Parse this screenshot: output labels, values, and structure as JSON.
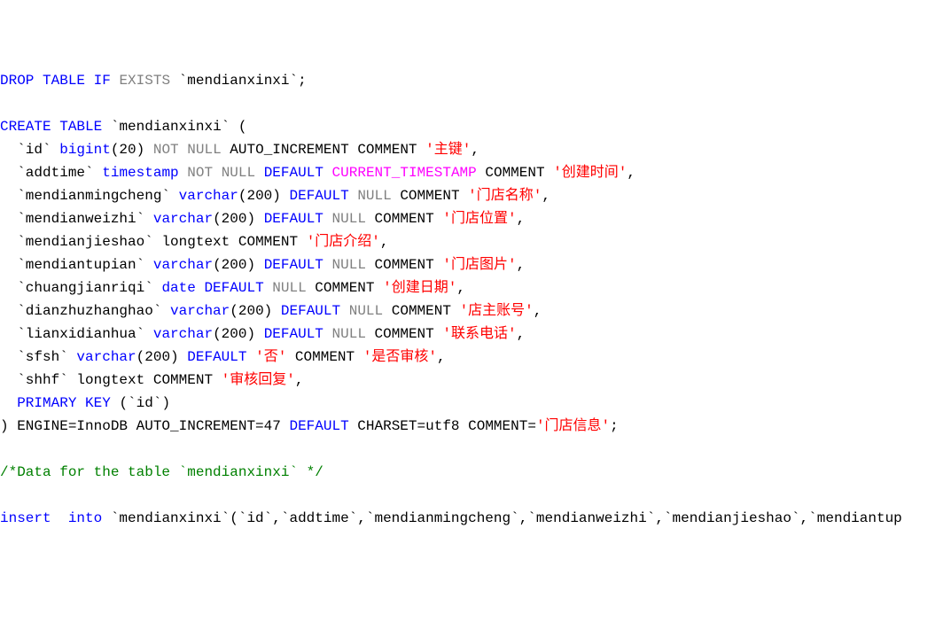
{
  "lines": {
    "l1_drop": "DROP",
    "l1_table": "TABLE",
    "l1_if": "IF",
    "l1_exists": "EXISTS",
    "l1_name": "`mendianxinxi`;",
    "l3_create": "CREATE",
    "l3_table": "TABLE",
    "l3_name": "`mendianxinxi` (",
    "l4_field": "  `id`",
    "l4_type": "bigint",
    "l4_size": "(20)",
    "l4_not": "NOT",
    "l4_null": "NULL",
    "l4_auto": "AUTO_INCREMENT",
    "l4_comment": "COMMENT",
    "l4_str": "'主键'",
    "l4_end": ",",
    "l5_field": "  `addtime`",
    "l5_type": "timestamp",
    "l5_not": "NOT",
    "l5_null": "NULL",
    "l5_default": "DEFAULT",
    "l5_curts": "CURRENT_TIMESTAMP",
    "l5_comment": "COMMENT",
    "l5_str": "'创建时间'",
    "l5_end": ",",
    "l6_field": "  `mendianmingcheng`",
    "l6_type": "varchar",
    "l6_size": "(200)",
    "l6_default": "DEFAULT",
    "l6_null": "NULL",
    "l6_comment": "COMMENT",
    "l6_str": "'门店名称'",
    "l6_end": ",",
    "l7_field": "  `mendianweizhi`",
    "l7_type": "varchar",
    "l7_size": "(200)",
    "l7_default": "DEFAULT",
    "l7_null": "NULL",
    "l7_comment": "COMMENT",
    "l7_str": "'门店位置'",
    "l7_end": ",",
    "l8_field": "  `mendianjieshao`",
    "l8_type": "longtext",
    "l8_comment": "COMMENT",
    "l8_str": "'门店介绍'",
    "l8_end": ",",
    "l9_field": "  `mendiantupian`",
    "l9_type": "varchar",
    "l9_size": "(200)",
    "l9_default": "DEFAULT",
    "l9_null": "NULL",
    "l9_comment": "COMMENT",
    "l9_str": "'门店图片'",
    "l9_end": ",",
    "l10_field": "  `chuangjianriqi`",
    "l10_type": "date",
    "l10_default": "DEFAULT",
    "l10_null": "NULL",
    "l10_comment": "COMMENT",
    "l10_str": "'创建日期'",
    "l10_end": ",",
    "l11_field": "  `dianzhuzhanghao`",
    "l11_type": "varchar",
    "l11_size": "(200)",
    "l11_default": "DEFAULT",
    "l11_null": "NULL",
    "l11_comment": "COMMENT",
    "l11_str": "'店主账号'",
    "l11_end": ",",
    "l12_field": "  `lianxidianhua`",
    "l12_type": "varchar",
    "l12_size": "(200)",
    "l12_default": "DEFAULT",
    "l12_null": "NULL",
    "l12_comment": "COMMENT",
    "l12_str": "'联系电话'",
    "l12_end": ",",
    "l13_field": "  `sfsh`",
    "l13_type": "varchar",
    "l13_size": "(200)",
    "l13_default": "DEFAULT",
    "l13_str1": "'否'",
    "l13_comment": "COMMENT",
    "l13_str2": "'是否审核'",
    "l13_end": ",",
    "l14_field": "  `shhf`",
    "l14_type": "longtext",
    "l14_comment": "COMMENT",
    "l14_str": "'审核回复'",
    "l14_end": ",",
    "l15_pk": "  PRIMARY",
    "l15_key": "KEY",
    "l15_id": "(`id`)",
    "l16_close": ") ENGINE=InnoDB AUTO_INCREMENT=47",
    "l16_default": "DEFAULT",
    "l16_charset": "CHARSET=utf8",
    "l16_comment": "COMMENT=",
    "l16_str": "'门店信息'",
    "l16_end": ";",
    "l18_comment": "/*Data for the table `mendianxinxi` */",
    "l20_insert": "insert",
    "l20_into": "into",
    "l20_rest": "`mendianxinxi`(`id`,`addtime`,`mendianmingcheng`,`mendianweizhi`,`mendianjieshao`,`mendiantup"
  }
}
